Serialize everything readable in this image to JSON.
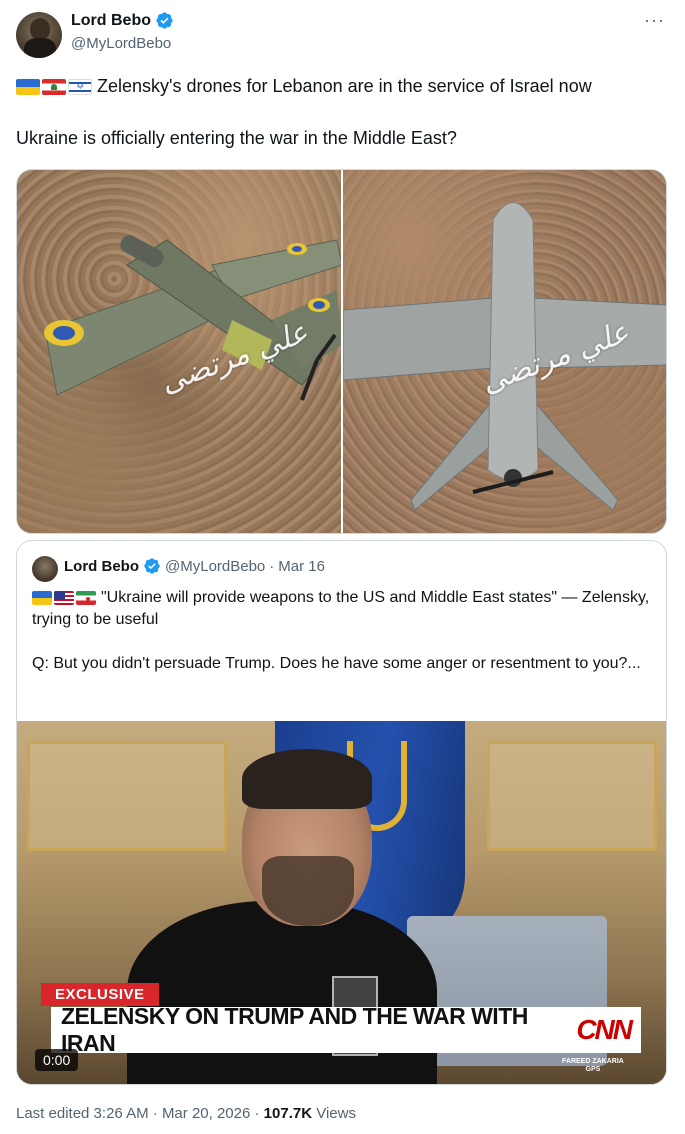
{
  "author": {
    "name": "Lord Bebo",
    "handle": "@MyLordBebo",
    "verified_color": "#1d9bf0"
  },
  "more_label": "···",
  "tweet": {
    "flags": [
      "ukraine-flag",
      "lebanon-flag",
      "israel-flag"
    ],
    "line1": "Zelensky's drones for Lebanon are in the service of Israel now",
    "line2": "Ukraine is officially entering the war in the Middle East?"
  },
  "media": {
    "watermark": "علي مرتضى",
    "images": [
      "drone-photo-left",
      "drone-photo-right"
    ]
  },
  "quote": {
    "name": "Lord Bebo",
    "handle": "@MyLordBebo",
    "separator": "·",
    "date": "Mar 16",
    "flags": [
      "ukraine-flag",
      "us-flag",
      "iran-flag"
    ],
    "text1": "\"Ukraine will provide weapons to the US and Middle East states\" — Zelensky, trying to be useful",
    "text2": "Q: But you didn't persuade Trump. Does he have some anger or resentment to you?...",
    "video": {
      "badge": "EXCLUSIVE",
      "chyron": "ZELENSKY ON TRUMP AND THE WAR WITH IRAN",
      "network": "CNN",
      "show_line1": "FAREED ZAKARIA",
      "show_line2": "GPS",
      "duration": "0:00"
    }
  },
  "meta": {
    "edited": "Last edited 3:26 AM",
    "sep1": "·",
    "date": "Mar 20, 2026",
    "sep2": "·",
    "views_count": "107.7K",
    "views_label": "Views"
  }
}
